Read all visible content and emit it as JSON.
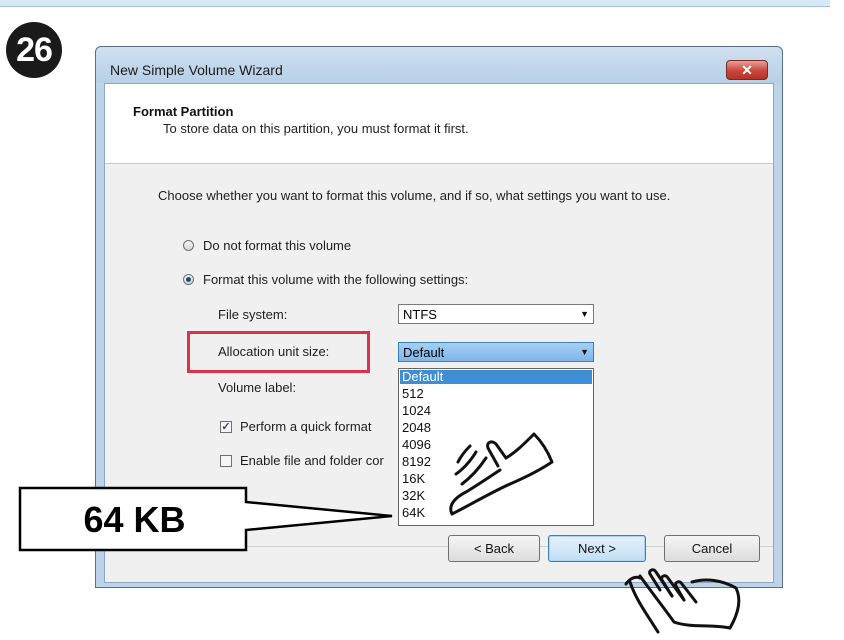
{
  "step_badge": "26",
  "window": {
    "title": "New Simple Volume Wizard",
    "close_glyph": "✕"
  },
  "header": {
    "title": "Format Partition",
    "subtitle": "To store data on this partition, you must format it first."
  },
  "body": {
    "instruction": "Choose whether you want to format this volume, and if so, what settings you want to use.",
    "radio_no_format": "Do not format this volume",
    "radio_format": "Format this volume with the following settings:",
    "selected_radio": "format",
    "file_system_label": "File system:",
    "file_system_value": "NTFS",
    "alloc_label": "Allocation unit size:",
    "alloc_value": "Default",
    "volume_label_label": "Volume label:",
    "quick_format_label": "Perform a quick format",
    "quick_format_checked": true,
    "compression_label": "Enable file and folder cor"
  },
  "dropdown": {
    "options": [
      "Default",
      "512",
      "1024",
      "2048",
      "4096",
      "8192",
      "16K",
      "32K",
      "64K"
    ],
    "highlighted": "Default"
  },
  "buttons": {
    "back": "< Back",
    "next": "Next >",
    "cancel": "Cancel"
  },
  "callout": {
    "text": "64 KB",
    "highlight_color": "#e0314b"
  },
  "icons": [
    "close-icon",
    "pointing-hand-icon",
    "clicking-hand-icon",
    "chevron-down-icon",
    "checkmark-icon"
  ]
}
